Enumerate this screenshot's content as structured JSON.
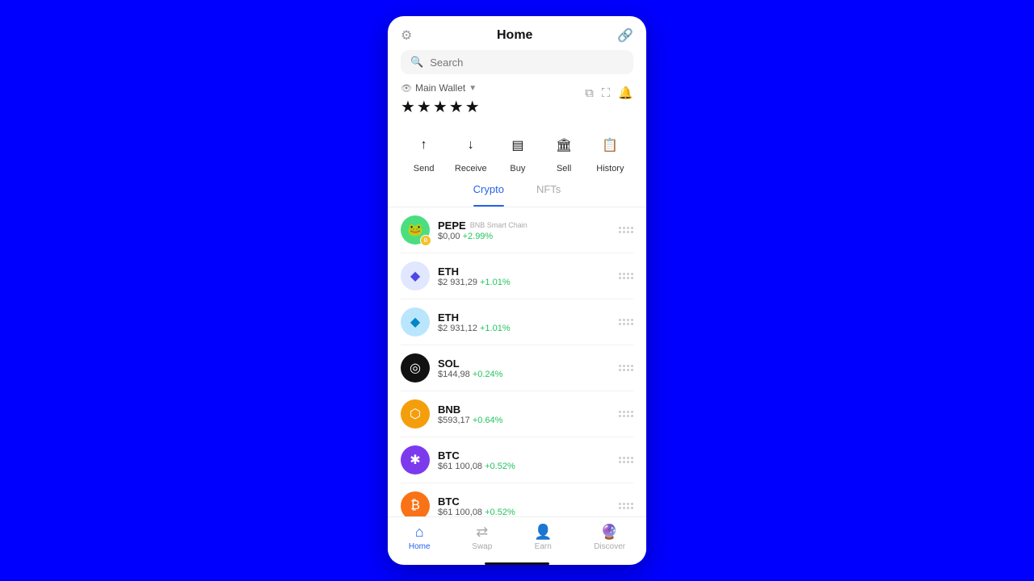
{
  "header": {
    "title": "Home",
    "settings_icon": "⚙",
    "profile_icon": "🔗"
  },
  "search": {
    "placeholder": "Search"
  },
  "wallet": {
    "label": "Main Wallet",
    "label_icon": "👁",
    "balance_mask": "★★★★★",
    "actions": [
      "copy",
      "expand",
      "bell"
    ]
  },
  "quick_actions": [
    {
      "id": "send",
      "label": "Send",
      "icon": "↑"
    },
    {
      "id": "receive",
      "label": "Receive",
      "icon": "↓"
    },
    {
      "id": "buy",
      "label": "Buy",
      "icon": "▤"
    },
    {
      "id": "sell",
      "label": "Sell",
      "icon": "🏛"
    },
    {
      "id": "history",
      "label": "History",
      "icon": "📋"
    }
  ],
  "tabs": [
    {
      "id": "crypto",
      "label": "Crypto",
      "active": true
    },
    {
      "id": "nfts",
      "label": "NFTs",
      "active": false
    }
  ],
  "crypto_list": [
    {
      "symbol": "PEPE",
      "chain": "BNB Smart Chain",
      "price": "$0,00",
      "change": "+2.99%",
      "change_type": "pos",
      "avatar_color": "pepe",
      "avatar_emoji": "🐸",
      "has_chain_badge": true,
      "chain_badge_color": "#f3c12a"
    },
    {
      "symbol": "ETH",
      "chain": "",
      "price": "$2 931,29",
      "change": "+1.01%",
      "change_type": "pos",
      "avatar_color": "eth",
      "avatar_emoji": "◆",
      "has_chain_badge": false
    },
    {
      "symbol": "ETH",
      "chain": "",
      "price": "$2 931,12",
      "change": "+1.01%",
      "change_type": "pos",
      "avatar_color": "eth2",
      "avatar_emoji": "◆",
      "has_chain_badge": false
    },
    {
      "symbol": "SOL",
      "chain": "",
      "price": "$144,98",
      "change": "+0.24%",
      "change_type": "pos",
      "avatar_color": "sol",
      "avatar_emoji": "◎",
      "has_chain_badge": false
    },
    {
      "symbol": "BNB",
      "chain": "",
      "price": "$593,17",
      "change": "+0.64%",
      "change_type": "pos",
      "avatar_color": "bnb",
      "avatar_emoji": "⬡",
      "has_chain_badge": false
    },
    {
      "symbol": "BTC",
      "chain": "",
      "price": "$61 100,08",
      "change": "+0.52%",
      "change_type": "pos",
      "avatar_color": "btc-purple",
      "avatar_emoji": "✱",
      "has_chain_badge": false
    },
    {
      "symbol": "BTC",
      "chain": "",
      "price": "$61 100,08",
      "change": "+0.52%",
      "change_type": "pos",
      "avatar_color": "btc-orange",
      "avatar_emoji": "₿",
      "has_chain_badge": false
    }
  ],
  "bottom_nav": [
    {
      "id": "home",
      "label": "Home",
      "icon": "⌂",
      "active": true
    },
    {
      "id": "swap",
      "label": "Swap",
      "icon": "⇄",
      "active": false
    },
    {
      "id": "earn",
      "label": "Earn",
      "icon": "👤",
      "active": false
    },
    {
      "id": "discover",
      "label": "Discover",
      "icon": "🔮",
      "active": false
    }
  ]
}
